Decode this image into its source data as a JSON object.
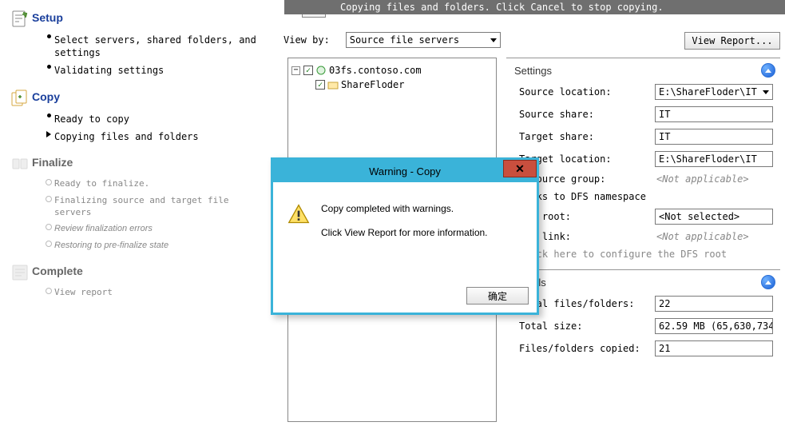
{
  "banner": {
    "text": "Copying files and folders. Click Cancel to stop copying."
  },
  "left": {
    "setup": {
      "title": "Setup",
      "items": [
        "Select servers, shared folders, and settings",
        "Validating settings"
      ]
    },
    "copy": {
      "title": "Copy",
      "items": [
        "Ready to copy",
        "Copying files and folders"
      ]
    },
    "finalize": {
      "title": "Finalize",
      "items": [
        "Ready to finalize.",
        "Finalizing source and target file servers",
        "Review finalization errors",
        "Restoring to pre-finalize state"
      ]
    },
    "complete": {
      "title": "Complete",
      "items": [
        "View report"
      ]
    }
  },
  "viewby": {
    "label": "View by:",
    "selected": "Source file servers"
  },
  "view_report_button": "View Report...",
  "tree": {
    "root": "03fs.contoso.com",
    "child": "ShareFloder"
  },
  "settings": {
    "title": "Settings",
    "rows": {
      "source_location": {
        "label": "Source location:",
        "value": "E:\\ShareFloder\\IT",
        "type": "select"
      },
      "source_share": {
        "label": "Source share:",
        "value": "IT",
        "type": "box"
      },
      "target_share": {
        "label": "Target share:",
        "value": "IT",
        "type": "box"
      },
      "target_location": {
        "label": "Target location:",
        "value": "E:\\ShareFloder\\IT",
        "type": "box"
      },
      "resource_group": {
        "label": "Resource group:",
        "value": "<Not applicable>",
        "type": "plain"
      },
      "dfs_links_head": {
        "label": "Links to DFS namespace"
      },
      "dfs_root": {
        "label": "DFS root:",
        "value": "<Not selected>",
        "type": "box"
      },
      "dfs_link": {
        "label": "DFS link:",
        "value": "<Not applicable>",
        "type": "plain"
      }
    },
    "hint": "Click here to configure the DFS root"
  },
  "details": {
    "title": "Details",
    "rows": {
      "total_files": {
        "label": "Total files/folders:",
        "value": "22"
      },
      "total_size": {
        "label": "Total size:",
        "value": "62.59 MB (65,630,734"
      },
      "files_copied": {
        "label": "Files/folders copied:",
        "value": "21"
      }
    }
  },
  "modal": {
    "title": "Warning - Copy",
    "line1": "Copy completed with warnings.",
    "line2": "Click View Report for more information.",
    "ok": "确定"
  }
}
